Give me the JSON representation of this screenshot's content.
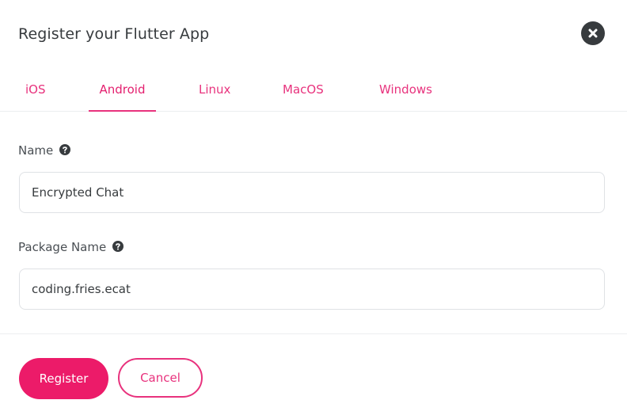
{
  "dialog": {
    "title": "Register your Flutter App"
  },
  "tabs": [
    {
      "label": "iOS",
      "active": false
    },
    {
      "label": "Android",
      "active": true
    },
    {
      "label": "Linux",
      "active": false
    },
    {
      "label": "MacOS",
      "active": false
    },
    {
      "label": "Windows",
      "active": false
    }
  ],
  "form": {
    "name_label": "Name",
    "name_value": "Encrypted Chat",
    "package_label": "Package Name",
    "package_value": "coding.fries.ecat"
  },
  "footer": {
    "register_label": "Register",
    "cancel_label": "Cancel"
  },
  "icons": {
    "close": "close-icon",
    "help": "question-circle-icon"
  },
  "colors": {
    "accent": "#ec1b69",
    "text": "#373b3e",
    "border": "#dfe2e5"
  }
}
